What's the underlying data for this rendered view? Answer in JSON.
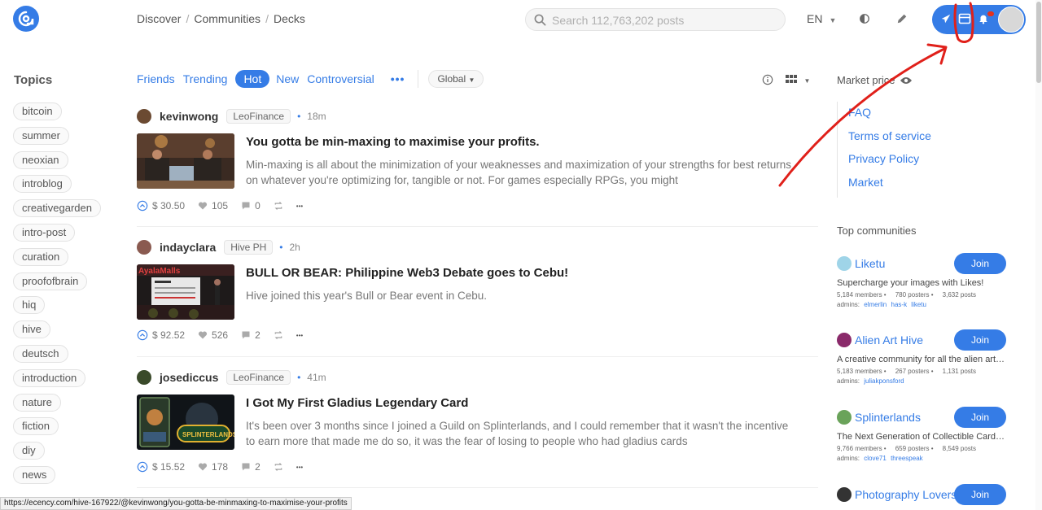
{
  "header": {
    "breadcrumb": [
      "Discover",
      "Communities",
      "Decks"
    ],
    "search_placeholder": "Search 112,763,202 posts",
    "lang": "EN"
  },
  "topics": {
    "title": "Topics",
    "items": [
      "bitcoin",
      "summer",
      "neoxian",
      "introblog",
      "creativegarden",
      "intro-post",
      "curation",
      "proofofbrain",
      "hiq",
      "hive",
      "deutsch",
      "introduction",
      "nature",
      "fiction",
      "diy",
      "news"
    ]
  },
  "tabs": {
    "items": [
      "Friends",
      "Trending",
      "Hot",
      "New",
      "Controversial"
    ],
    "active": "Hot",
    "more": "•••",
    "filter": "Global"
  },
  "posts": [
    {
      "author": "kevinwong",
      "community": "LeoFinance",
      "dot": "•",
      "time": "18m",
      "title": "You gotta be min-maxing to maximise your profits.",
      "body": "Min-maxing is all about the minimization of your weaknesses and maximization of your strengths for best returns on whatever you're optimizing for, tangible or not. For games especially RPGs, you might",
      "payout": "$ 30.50",
      "votes": "105",
      "comments": "0",
      "more": "•••"
    },
    {
      "author": "indayclara",
      "community": "Hive PH",
      "dot": "•",
      "time": "2h",
      "title": "BULL OR BEAR: Philippine Web3 Debate goes to Cebu!",
      "body": "Hive joined this year's Bull or Bear event in Cebu.",
      "payout": "$ 92.52",
      "votes": "526",
      "comments": "2",
      "more": "•••"
    },
    {
      "author": "josediccus",
      "community": "LeoFinance",
      "dot": "•",
      "time": "41m",
      "title": "I Got My First Gladius Legendary Card",
      "body": "It's been over 3 months since I joined a Guild on Splinterlands, and I could remember that it wasn't the incentive to earn more that made me do so, it was the fear of losing to people who had gladius cards",
      "payout": "$ 15.52",
      "votes": "178",
      "comments": "2",
      "more": "•••"
    }
  ],
  "market": {
    "title": "Market price",
    "links": [
      "FAQ",
      "Terms of service",
      "Privacy Policy",
      "Market"
    ]
  },
  "top_communities": {
    "title": "Top communities",
    "join_label": "Join",
    "items": [
      {
        "name": "Liketu",
        "desc": "Supercharge your images with Likes!",
        "stats": "5,184 members •     780 posters •     3,632 posts",
        "admins_label": "admins:",
        "admins": [
          "elmerlin",
          "has-k",
          "liketu"
        ],
        "color": "#9fd4e8"
      },
      {
        "name": "Alien Art Hive",
        "desc": "A creative community for all the alien artists…",
        "stats": "5,183 members •     267 posters •     1,131 posts",
        "admins_label": "admins:",
        "admins": [
          "juliakponsford"
        ],
        "color": "#8a2a6a"
      },
      {
        "name": "Splinterlands",
        "desc": "The Next Generation of Collectible Card G…",
        "stats": "9,766 members •     659 posters •     8,549 posts",
        "admins_label": "admins:",
        "admins": [
          "clove71",
          "threespeak"
        ],
        "color": "#6aa35a"
      },
      {
        "name": "Photography Lovers",
        "color": "#333333"
      }
    ]
  },
  "statusbar": {
    "url": "https://ecency.com/hive-167922/@kevinwong/you-gotta-be-minmaxing-to-maximise-your-profits"
  },
  "colors": {
    "accent": "#357ce6",
    "annotation": "#e0201a"
  }
}
